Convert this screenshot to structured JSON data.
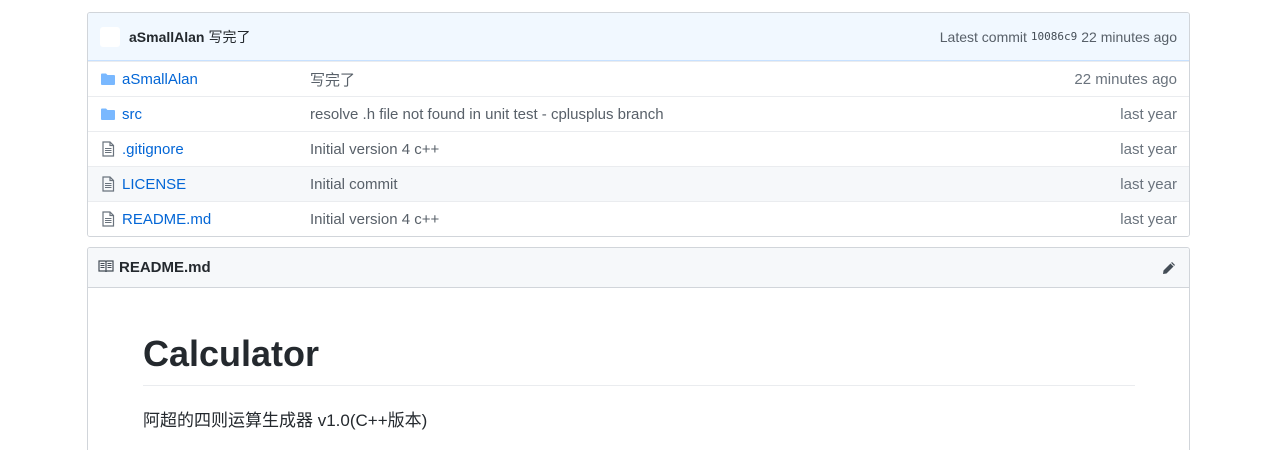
{
  "commit_bar": {
    "author": "aSmallAlan",
    "message": "写完了",
    "latest_label": "Latest commit",
    "sha": "10086c9",
    "age": "22 minutes ago"
  },
  "files": [
    {
      "type": "folder",
      "icon": "folder-icon",
      "name": "aSmallAlan",
      "message": "写完了",
      "age": "22 minutes ago"
    },
    {
      "type": "folder",
      "icon": "folder-icon",
      "name": "src",
      "message": "resolve .h file not found in unit test - cplusplus branch",
      "age": "last year"
    },
    {
      "type": "file",
      "icon": "file-icon",
      "name": ".gitignore",
      "message": "Initial version 4 c++",
      "age": "last year"
    },
    {
      "type": "file",
      "icon": "file-icon",
      "name": "LICENSE",
      "message": "Initial commit",
      "age": "last year"
    },
    {
      "type": "file",
      "icon": "file-icon",
      "name": "README.md",
      "message": "Initial version 4 c++",
      "age": "last year"
    }
  ],
  "readme": {
    "title": "README.md",
    "heading": "Calculator",
    "paragraph": "阿超的四则运算生成器 v1.0(C++版本)"
  },
  "colors": {
    "link": "#0366d6",
    "folder_icon": "#79b8ff",
    "commit_bar_bg": "#f1f8ff"
  }
}
